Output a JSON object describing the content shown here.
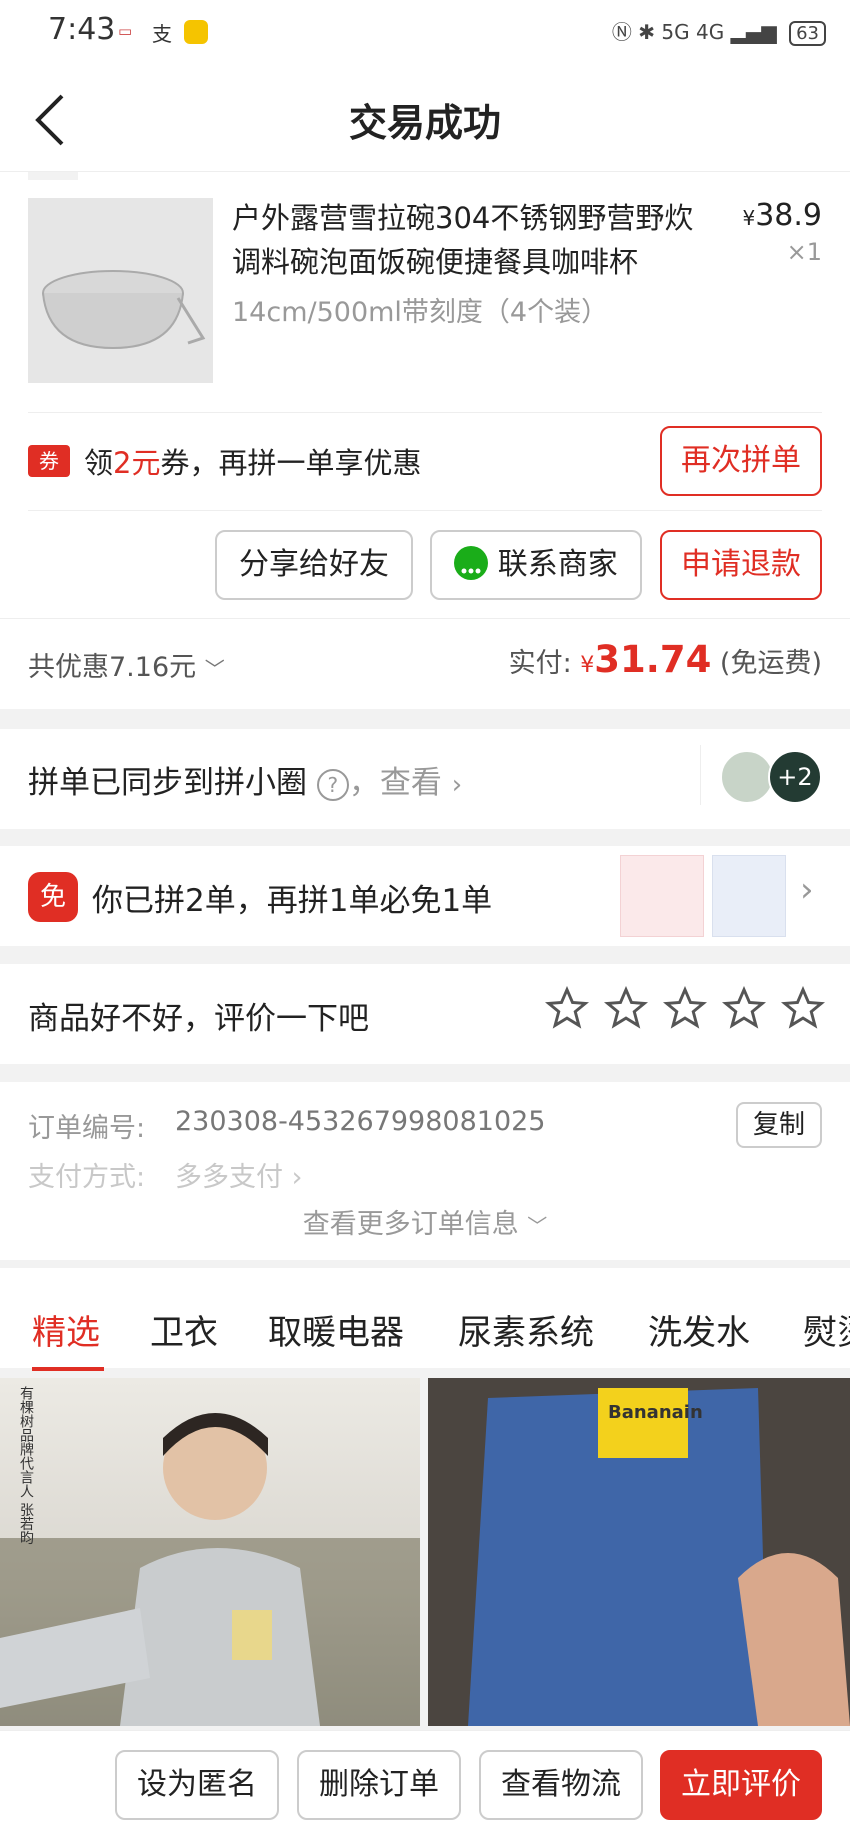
{
  "status_bar": {
    "time": "7:43",
    "left_icons": [
      "app-badge-icon",
      "alipay-icon",
      "assistant-icon"
    ],
    "right_text": "5G 4G",
    "battery": "63"
  },
  "header": {
    "title": "交易成功"
  },
  "product": {
    "title": "户外露营雪拉碗304不锈钢野营野炊调料碗泡面饭碗便捷餐具咖啡杯",
    "spec": "14cm/500ml带刻度（4个装）",
    "price_symbol": "¥",
    "price": "38.9",
    "quantity": "×1"
  },
  "coupon": {
    "tag": "券",
    "prefix": "领",
    "amount": "2元",
    "suffix": "券，再拼一单享优惠",
    "rebuy_label": "再次拼单"
  },
  "actions": {
    "share": "分享给好友",
    "contact": "联系商家",
    "refund": "申请退款"
  },
  "summary": {
    "discount": "共优惠7.16元",
    "paid_label": "实付:",
    "currency": "¥",
    "paid_amount": "31.74",
    "shipping": "(免运费)"
  },
  "sync": {
    "text": "拼单已同步到拼小圈",
    "help": "?",
    "view": "，查看",
    "extra_count": "+2"
  },
  "free_promo": {
    "badge": "免",
    "text": "你已拼2单，再拼1单必免1单"
  },
  "review": {
    "prompt": "商品好不好，评价一下吧",
    "rating": 0,
    "max_rating": 5
  },
  "order": {
    "number_label": "订单编号:",
    "number": "230308-453267998081025",
    "copy_label": "复制",
    "payment_label": "支付方式:",
    "payment": "多多支付",
    "more_label": "查看更多订单信息"
  },
  "tabs": [
    "精选",
    "卫衣",
    "取暖电器",
    "尿素系统",
    "洗发水",
    "熨烫"
  ],
  "feed": [
    {
      "caption": "有棵树品牌代言人 张若昀"
    },
    {
      "caption": "Bananain"
    }
  ],
  "bottom": {
    "anonymous": "设为匿名",
    "delete": "删除订单",
    "logistics": "查看物流",
    "review_now": "立即评价"
  },
  "colors": {
    "accent": "#e02e24",
    "background": "#f2f2f2"
  }
}
